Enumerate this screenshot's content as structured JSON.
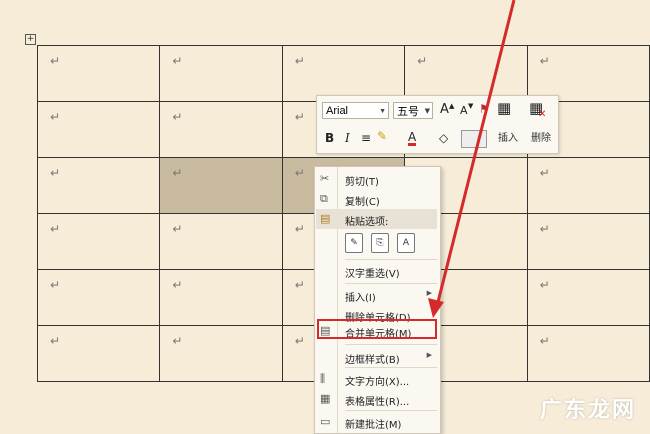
{
  "table": {
    "rows": 6,
    "cols": 5,
    "paragraph_mark": "↵",
    "selected_cells": [
      [
        2,
        1
      ],
      [
        2,
        2
      ]
    ]
  },
  "mini_toolbar": {
    "font_name": "Arial",
    "font_size": "五号",
    "grow_font": "A",
    "shrink_font": "A",
    "bold": "B",
    "italic": "I",
    "font_color": "A",
    "insert_label": "插入",
    "delete_label": "删除"
  },
  "context_menu": {
    "items": [
      {
        "label": "剪切(T)",
        "icon": "scissors-icon"
      },
      {
        "label": "复制(C)",
        "icon": "copy-icon"
      },
      {
        "label": "粘贴选项:",
        "icon": "paste-icon"
      },
      {
        "label": "汉字重选(V)",
        "icon": ""
      },
      {
        "label": "插入(I)",
        "icon": ""
      },
      {
        "label": "删除单元格(D)...",
        "icon": ""
      },
      {
        "label": "合并单元格(M)",
        "icon": "merge-cells-icon"
      },
      {
        "label": "边框样式(B)",
        "icon": ""
      },
      {
        "label": "文字方向(X)...",
        "icon": "text-direction-icon"
      },
      {
        "label": "表格属性(R)...",
        "icon": "table-properties-icon"
      },
      {
        "label": "新建批注(M)",
        "icon": "new-comment-icon"
      }
    ],
    "paste_options": [
      "✎",
      "⎘",
      "A"
    ]
  },
  "watermark": "广东龙网",
  "colors": {
    "background": "#f6ecd8",
    "highlight": "#d42a2a",
    "selection": "#c9bb9f"
  }
}
